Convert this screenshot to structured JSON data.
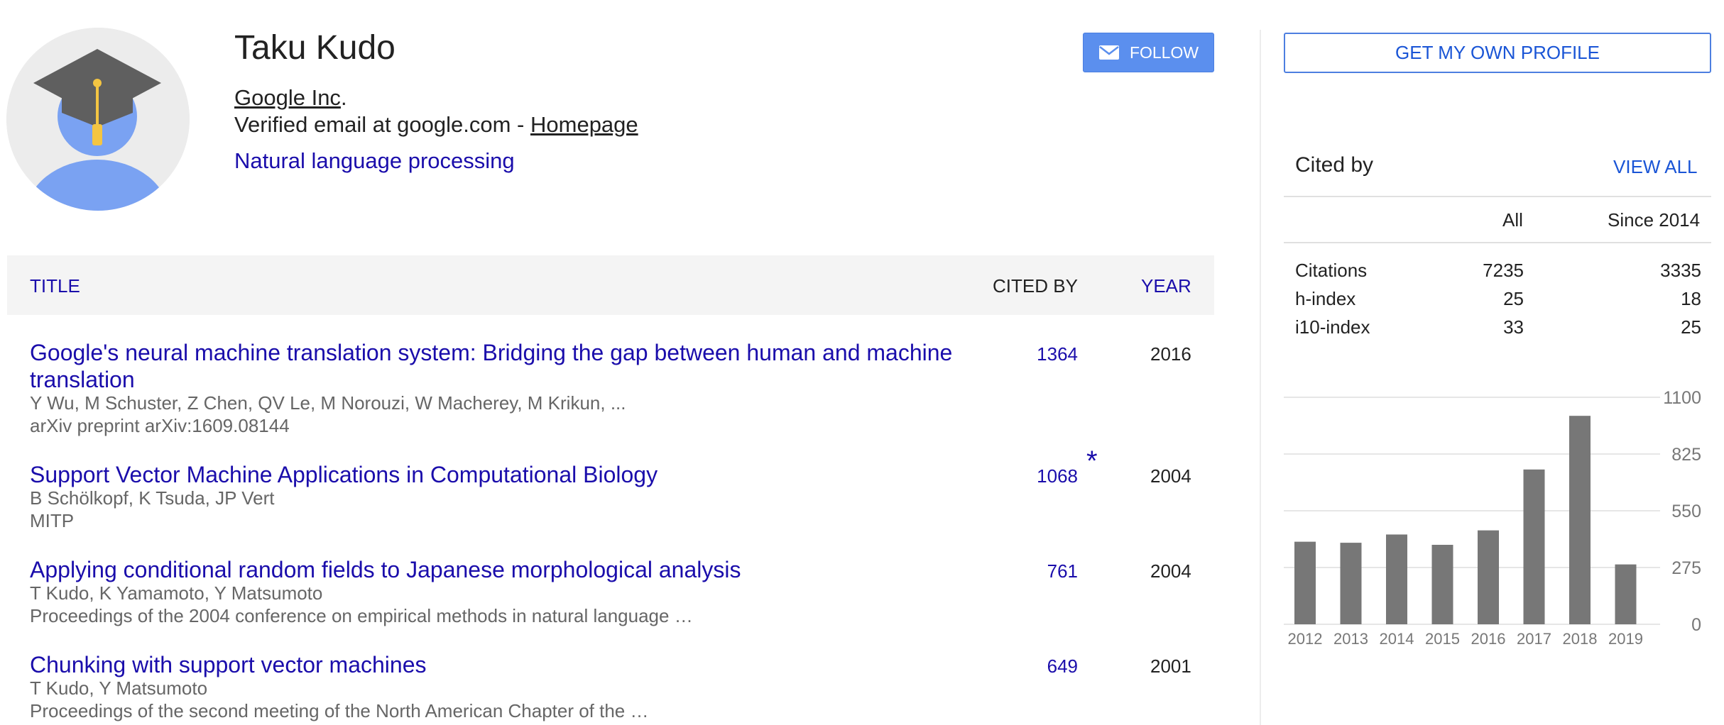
{
  "profile": {
    "name": "Taku Kudo",
    "affiliation": "Google Inc",
    "affiliation_suffix": ".",
    "verified_prefix": "Verified email at google.com - ",
    "homepage_label": "Homepage",
    "interest": "Natural language processing",
    "follow_label": "FOLLOW"
  },
  "table": {
    "headers": {
      "title": "TITLE",
      "cited_by": "CITED BY",
      "year": "YEAR"
    },
    "rows": [
      {
        "title": "Google's neural machine translation system: Bridging the gap between human and machine translation",
        "authors": "Y Wu, M Schuster, Z Chen, QV Le, M Norouzi, W Macherey, M Krikun, ...",
        "venue": "arXiv preprint arXiv:1609.08144",
        "cited": "1364",
        "year": "2016",
        "star": ""
      },
      {
        "title": "Support Vector Machine Applications in Computational Biology",
        "authors": "B Schölkopf, K Tsuda, JP Vert",
        "venue": "MITP",
        "cited": "1068",
        "year": "2004",
        "star": "*"
      },
      {
        "title": "Applying conditional random fields to Japanese morphological analysis",
        "authors": "T Kudo, K Yamamoto, Y Matsumoto",
        "venue": "Proceedings of the 2004 conference on empirical methods in natural language …",
        "cited": "761",
        "year": "2004",
        "star": ""
      },
      {
        "title": "Chunking with support vector machines",
        "authors": "T Kudo, Y Matsumoto",
        "venue": "Proceedings of the second meeting of the North American Chapter of the …",
        "cited": "649",
        "year": "2001",
        "star": ""
      }
    ]
  },
  "sidebar": {
    "own_profile_label": "GET MY OWN PROFILE",
    "cited_by_heading": "Cited by",
    "view_all_label": "VIEW ALL",
    "col_all": "All",
    "col_since": "Since 2014",
    "stats": [
      {
        "label": "Citations",
        "all": "7235",
        "since": "3335"
      },
      {
        "label": "h-index",
        "all": "25",
        "since": "18"
      },
      {
        "label": "i10-index",
        "all": "33",
        "since": "25"
      }
    ]
  },
  "chart_data": {
    "type": "bar",
    "categories": [
      "2012",
      "2013",
      "2014",
      "2015",
      "2016",
      "2017",
      "2018",
      "2019"
    ],
    "values": [
      400,
      395,
      435,
      385,
      455,
      750,
      1010,
      290
    ],
    "ylim": [
      0,
      1100
    ],
    "yticks": [
      "0",
      "275",
      "550",
      "825",
      "1100"
    ],
    "grid": true,
    "bar_color": "#777777"
  },
  "colors": {
    "link": "#1a0dab",
    "accent": "#5b8fee",
    "grad_cap": "#5f5f5f",
    "person": "#7aa2f2"
  }
}
